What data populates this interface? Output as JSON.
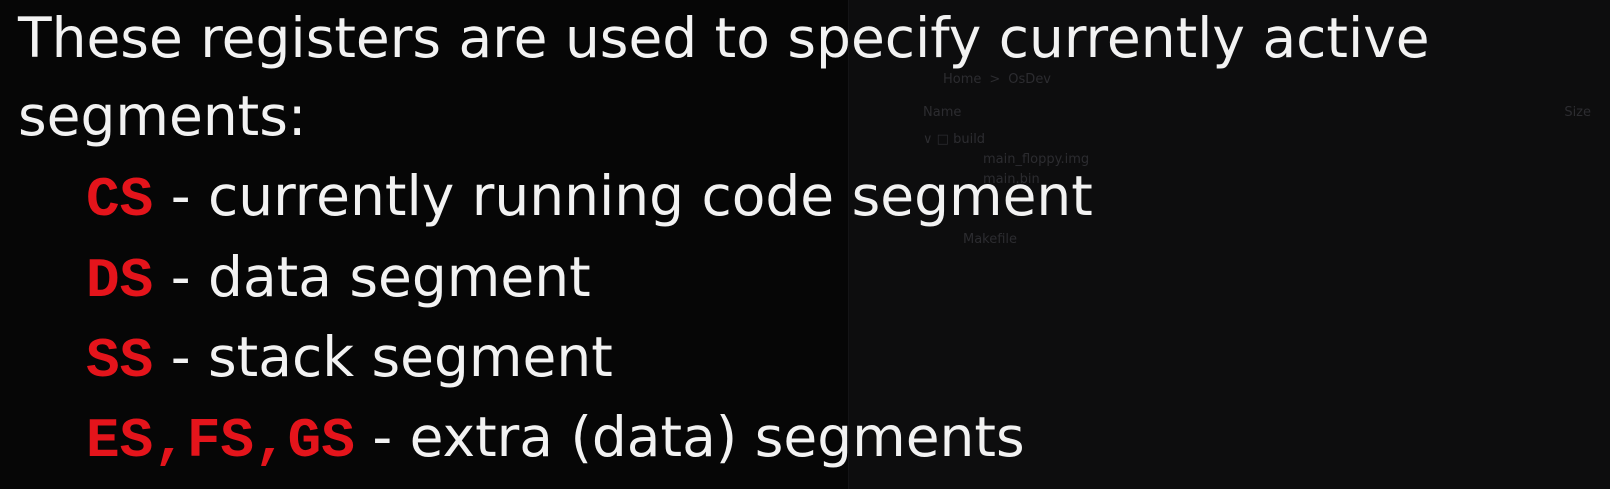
{
  "slide": {
    "intro_line_1": "These registers are used to specify currently active",
    "intro_line_2": "segments:",
    "registers": [
      {
        "name": "CS",
        "description": " - currently running code segment"
      },
      {
        "name": "DS",
        "description": " - data segment"
      },
      {
        "name": "SS",
        "description": " - stack segment"
      },
      {
        "name": "ES,FS,GS",
        "description": " - extra (data) segments"
      }
    ]
  },
  "background_window": {
    "breadcrumb": [
      "Home",
      ">",
      "OsDev"
    ],
    "columns": {
      "name": "Name",
      "size": "Size"
    },
    "tree": [
      {
        "label": "build",
        "icon": "folder-icon"
      },
      {
        "label": "main_floppy.img"
      },
      {
        "label": "main.bin"
      },
      {
        "label": "Makefile"
      }
    ]
  },
  "colors": {
    "background": "#060606",
    "text": "#f2f2f2",
    "register_highlight": "#e4141b"
  }
}
